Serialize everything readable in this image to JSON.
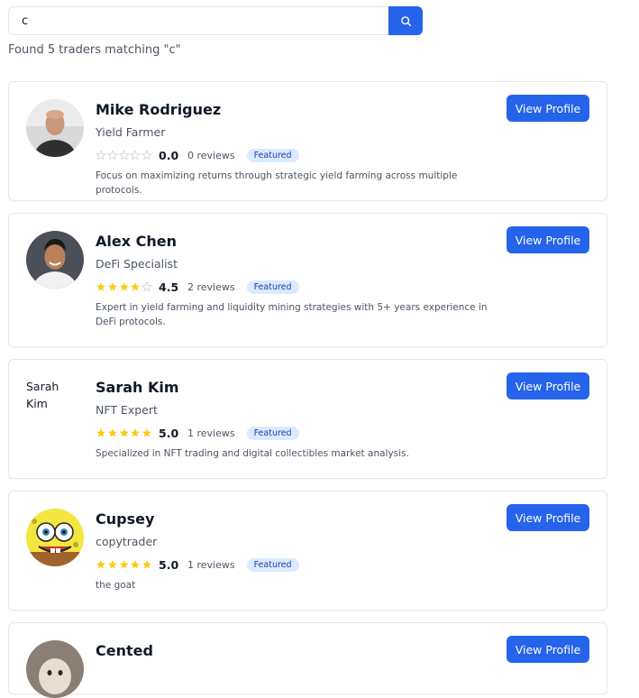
{
  "search": {
    "value": "c",
    "placeholder": ""
  },
  "results_text": "Found 5 traders matching \"c\"",
  "colors": {
    "accent": "#2563eb",
    "star_filled": "#facc15",
    "star_empty": "#d1d5db",
    "badge_bg": "#dbeafe",
    "badge_text": "#1e40af"
  },
  "traders": [
    {
      "name": "Mike Rodriguez",
      "role": "Yield Farmer",
      "stars": 0,
      "rating": "0.0",
      "reviews": "0 reviews",
      "badge": "Featured",
      "bio": "Focus on maximizing returns through strategic yield farming across multiple protocols.",
      "button": "View Profile",
      "avatar": "photo-avatar"
    },
    {
      "name": "Alex Chen",
      "role": "DeFi Specialist",
      "stars": 4,
      "rating": "4.5",
      "reviews": "2 reviews",
      "badge": "Featured",
      "bio": "Expert in yield farming and liquidity mining strategies with 5+ years experience in DeFi protocols.",
      "button": "View Profile",
      "avatar": "photo-avatar"
    },
    {
      "name": "Sarah Kim",
      "role": "NFT Expert",
      "stars": 5,
      "rating": "5.0",
      "reviews": "1 reviews",
      "badge": "Featured",
      "bio": "Specialized in NFT trading and digital collectibles market analysis.",
      "button": "View Profile",
      "avatar_alt": "Sarah Kim"
    },
    {
      "name": "Cupsey",
      "role": "copytrader",
      "stars": 5,
      "rating": "5.0",
      "reviews": "1 reviews",
      "badge": "Featured",
      "bio": "the goat",
      "button": "View Profile",
      "avatar": "cartoon-avatar"
    },
    {
      "name": "Cented",
      "button": "View Profile",
      "avatar": "photo-avatar"
    }
  ]
}
